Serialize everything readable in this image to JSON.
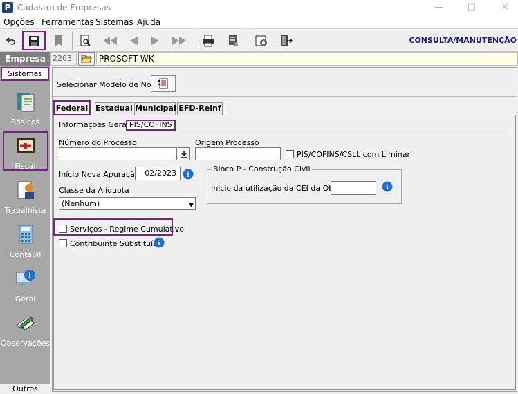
{
  "window": {
    "logo_letter": "P",
    "title": "Cadastro de Empresas"
  },
  "menu": [
    "Opções",
    "Ferramentas",
    "Sistemas",
    "Ajuda"
  ],
  "toolbar": {
    "mode_label": "CONSULTA/MANUTENÇÃO"
  },
  "sidebar": {
    "company_label": "Empresa",
    "sistemas_label": "Sistemas",
    "items": [
      {
        "label": "Básicos",
        "icon": "basicos-icon"
      },
      {
        "label": "Fiscal",
        "icon": "fiscal-icon"
      },
      {
        "label": "Trabalhista",
        "icon": "trabalhista-icon"
      },
      {
        "label": "Contábil",
        "icon": "calculator-icon"
      },
      {
        "label": "Geral",
        "icon": "geral-info-icon"
      },
      {
        "label": "Observações",
        "icon": "observacoes-icon"
      }
    ],
    "outros_label": "Outros"
  },
  "company": {
    "code": "2203",
    "name": "PROSOFT WK"
  },
  "model": {
    "label": "Selecionar Modelo de Nota"
  },
  "tabs": [
    "Federal",
    "Estadual",
    "Municipal",
    "EFD-Reinf"
  ],
  "subtabs": [
    "Informações Gerais",
    "PIS/COFINS"
  ],
  "form": {
    "numero_processo_label": "Número do Processo",
    "numero_processo_value": "",
    "origem_processo_label": "Origem Processo",
    "origem_processo_value": "",
    "liminar_label": "PIS/COFINS/CSLL com Liminar",
    "apuracao_label": "Início Nova Apuração:",
    "apuracao_value": "02/2023",
    "aliquota_label": "Classe da Alíquota",
    "aliquota_value": "(Nenhum)",
    "bloco_p_title": "Bloco P - Construção Civil",
    "cei_label": "Inicio da utilização da CEI da Obra:",
    "cei_value": "",
    "servicos_label": "Serviços - Regime Cumulativo",
    "contribuinte_label": "Contribuinte Substituído"
  },
  "colors": {
    "highlight": "#7b1f87",
    "sidebar": "#a7a7a7",
    "mode_text": "#1c1c7a",
    "company_bg": "#ffffe6"
  }
}
